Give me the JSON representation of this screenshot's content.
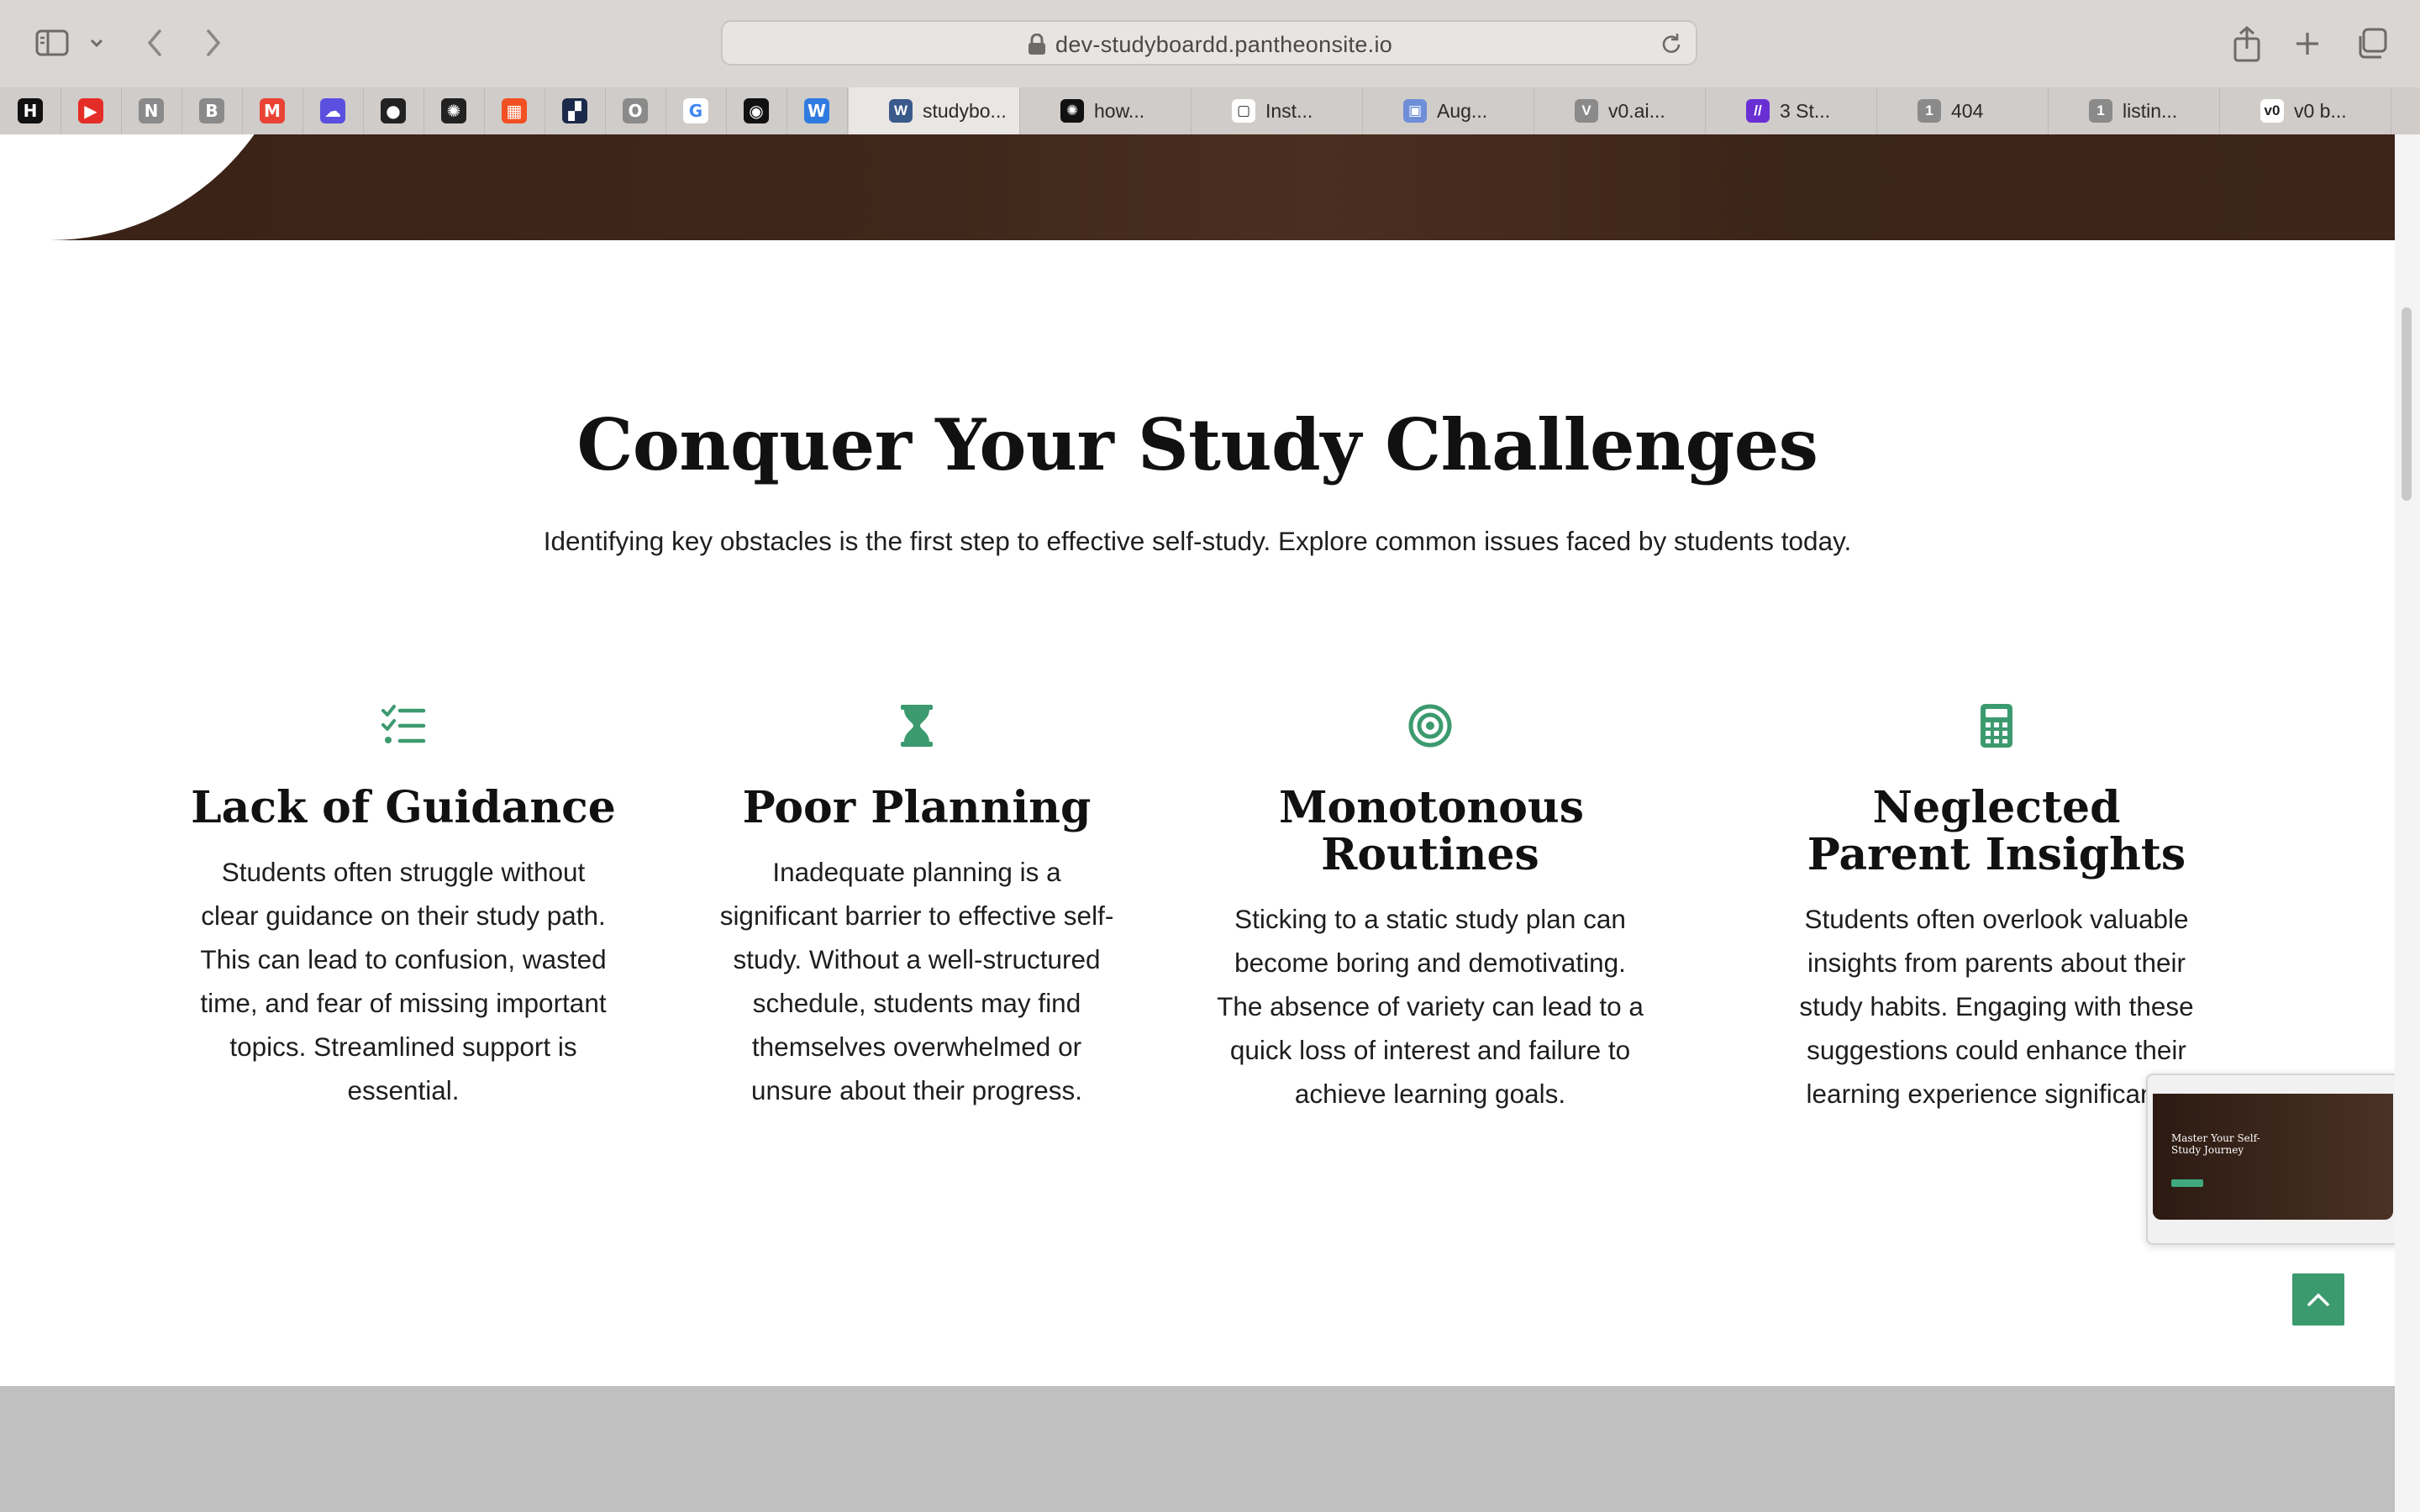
{
  "browser": {
    "url": "dev-studyboardd.pantheonsite.io",
    "favorites": [
      {
        "name": "hn-icon",
        "glyph": "H",
        "bg": "#111111"
      },
      {
        "name": "youtube-icon",
        "glyph": "▶",
        "bg": "#e52d27"
      },
      {
        "name": "notion-icon",
        "glyph": "N",
        "bg": "#8a8a8a"
      },
      {
        "name": "bookmark-b-icon",
        "glyph": "B",
        "bg": "#8a8a8a"
      },
      {
        "name": "gmail-icon",
        "glyph": "M",
        "bg": "#ea4335"
      },
      {
        "name": "cloud-app-icon",
        "glyph": "☁",
        "bg": "#5b4fe0"
      },
      {
        "name": "github-icon",
        "glyph": "●",
        "bg": "#222222"
      },
      {
        "name": "openai-icon",
        "glyph": "✺",
        "bg": "#222222"
      },
      {
        "name": "microsoft-icon",
        "glyph": "▦",
        "bg": "#f25022"
      },
      {
        "name": "app-squares-icon",
        "glyph": "▞",
        "bg": "#1b2a4a"
      },
      {
        "name": "bookmark-o-icon",
        "glyph": "O",
        "bg": "#8a8a8a"
      },
      {
        "name": "google-icon",
        "glyph": "G",
        "bg": "#ffffff"
      },
      {
        "name": "app-dark-icon",
        "glyph": "◉",
        "bg": "#111111"
      },
      {
        "name": "app-w-icon",
        "glyph": "W",
        "bg": "#2f7be0"
      }
    ],
    "tabs": [
      {
        "label": "studybo...",
        "glyph": "W",
        "bg": "#3a5a8c",
        "active": true
      },
      {
        "label": "how...",
        "glyph": "✺",
        "bg": "#111111"
      },
      {
        "label": "Inst...",
        "glyph": "▢",
        "bg": "#ffffff"
      },
      {
        "label": "Aug...",
        "glyph": "▣",
        "bg": "#6f8ed8"
      },
      {
        "label": "v0.ai...",
        "glyph": "V",
        "bg": "#8a8a8a"
      },
      {
        "label": "3 St...",
        "glyph": "//",
        "bg": "#6a2fd4"
      },
      {
        "label": "404",
        "glyph": "1",
        "bg": "#8a8a8a"
      },
      {
        "label": "listin...",
        "glyph": "1",
        "bg": "#8a8a8a"
      },
      {
        "label": "v0 b...",
        "glyph": "v0",
        "bg": "#ffffff"
      }
    ]
  },
  "section": {
    "title": "Conquer Your Study Challenges",
    "subtitle": "Identifying key obstacles is the first step to effective self-study. Explore common issues faced by students today."
  },
  "cards": [
    {
      "icon": "checklist-icon",
      "title": "Lack of Guidance",
      "text": "Students often struggle without clear guidance on their study path. This can lead to confusion, wasted time, and fear of missing important topics. Streamlined support is essential."
    },
    {
      "icon": "hourglass-icon",
      "title": "Poor Planning",
      "text": "Inadequate planning is a significant barrier to effective self-study. Without a well-structured schedule, students may find themselves overwhelmed or unsure about their progress."
    },
    {
      "icon": "target-icon",
      "title": "Monotonous Routines",
      "text": "Sticking to a static study plan can become boring and demotivating. The absence of variety can lead to a quick loss of interest and failure to achieve learning goals."
    },
    {
      "icon": "calculator-icon",
      "title": "Neglected Parent Insights",
      "text": "Students often overlook valuable insights from parents about their study habits. Engaging with these suggestions could enhance their learning experience significantly."
    }
  ],
  "preview": {
    "title": "Master Your Self-Study Journey"
  },
  "colors": {
    "accent": "#3c9a6f",
    "hero": "#3e271b",
    "footer": "#c1c0c0"
  }
}
